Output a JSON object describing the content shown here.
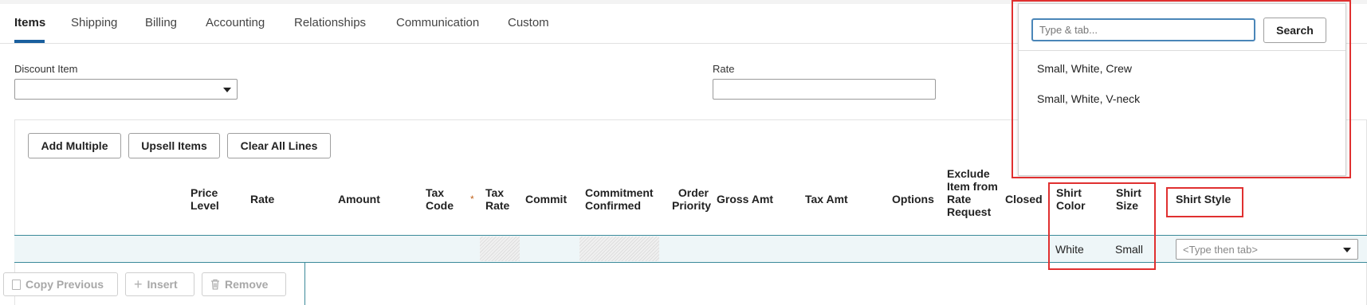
{
  "tabs": [
    {
      "label": "Items",
      "active": true
    },
    {
      "label": "Shipping",
      "active": false
    },
    {
      "label": "Billing",
      "active": false
    },
    {
      "label": "Accounting",
      "active": false
    },
    {
      "label": "Relationships",
      "active": false
    },
    {
      "label": "Communication",
      "active": false
    },
    {
      "label": "Custom",
      "active": false
    }
  ],
  "discount": {
    "label": "Discount Item",
    "value": ""
  },
  "rate": {
    "label": "Rate",
    "value": ""
  },
  "toolbar": {
    "add_multiple": "Add Multiple",
    "upsell": "Upsell Items",
    "clear_all": "Clear All Lines"
  },
  "columns": {
    "price_level": "Price Level",
    "rate": "Rate",
    "amount": "Amount",
    "tax_code": "Tax Code",
    "tax_code_required": "*",
    "tax_rate": "Tax Rate",
    "commit": "Commit",
    "commitment_confirmed": "Commitment Confirmed",
    "order_priority": "Order Priority",
    "gross_amt": "Gross Amt",
    "tax_amt": "Tax Amt",
    "options": "Options",
    "exclude_item": "Exclude Item from Rate Request",
    "closed": "Closed",
    "shirt_color": "Shirt Color",
    "shirt_size": "Shirt Size",
    "shirt_style": "Shirt Style"
  },
  "row": {
    "shirt_color": "White",
    "shirt_size": "Small",
    "shirt_style_placeholder": "<Type then tab>"
  },
  "line_buttons": {
    "copy_previous": "Copy Previous",
    "insert": "Insert",
    "remove": "Remove"
  },
  "popup": {
    "search_placeholder": "Type & tab...",
    "search_button": "Search",
    "options": [
      "Small, White, Crew",
      "Small, White, V-neck"
    ]
  },
  "colors": {
    "highlight": "#e03030",
    "accent": "#1a5f9e",
    "row_border": "#3b8a9a"
  }
}
